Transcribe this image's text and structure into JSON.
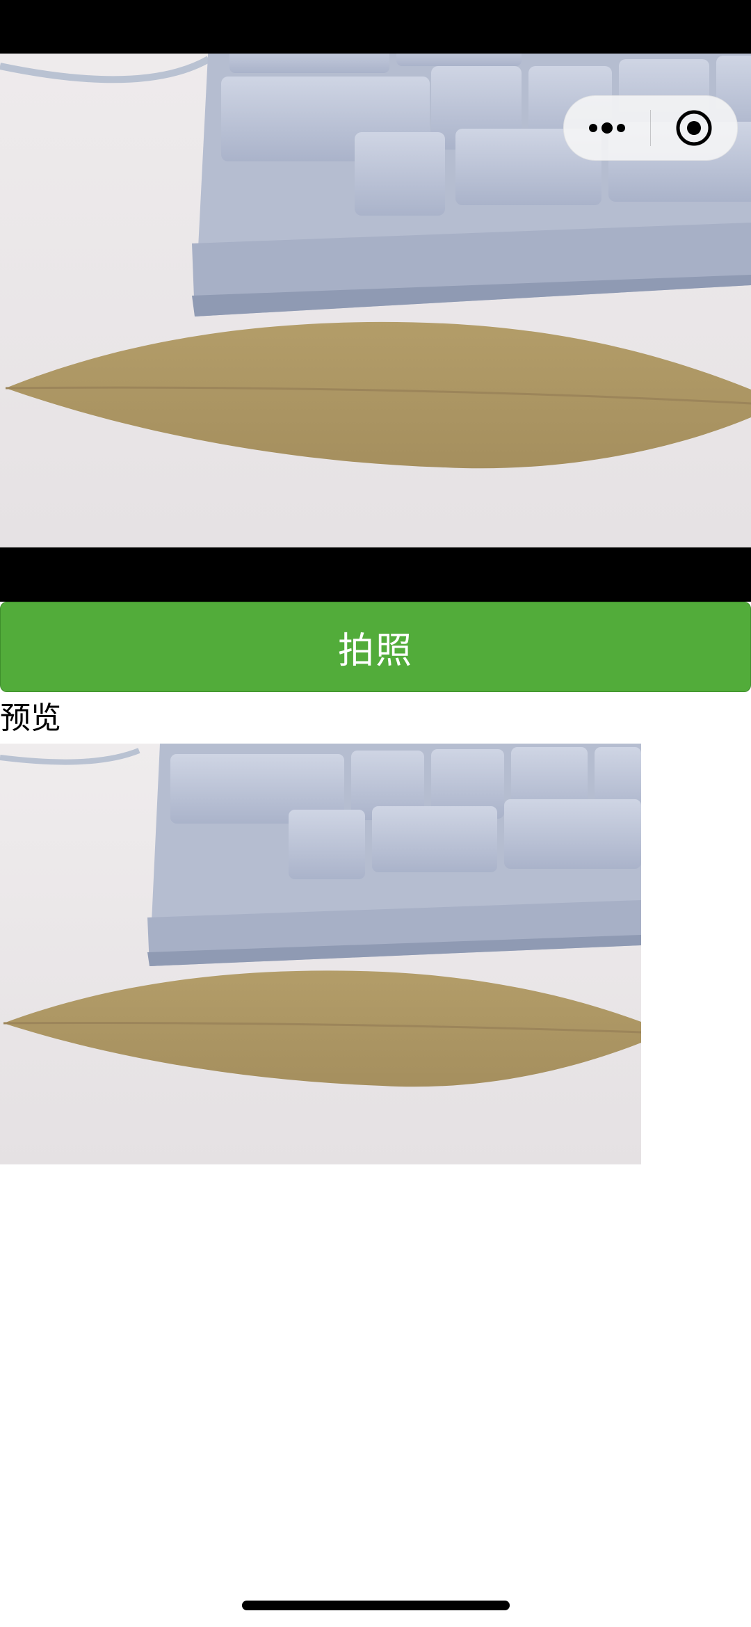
{
  "camera": {
    "capture_button_label": "拍照"
  },
  "capsule_menu": {
    "more_icon": "more-dots-icon",
    "close_icon": "target-close-icon"
  },
  "preview": {
    "label": "预览"
  },
  "colors": {
    "button_green": "#52ac3a",
    "black_band": "#000000",
    "background": "#ffffff"
  }
}
